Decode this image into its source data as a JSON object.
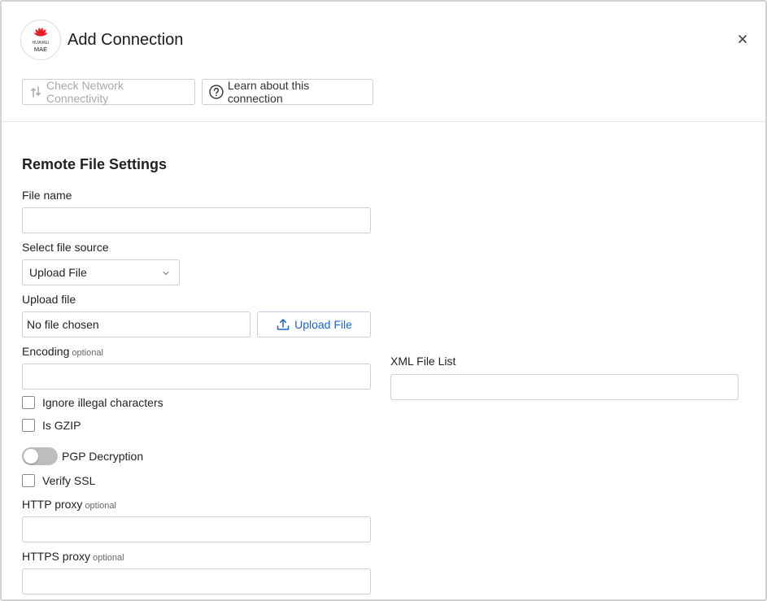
{
  "dialog": {
    "title": "Add Connection",
    "logo": {
      "brand": "HUAWEI",
      "sub": "MAE",
      "icon": "huawei-petal-logo",
      "color": "#e4202c"
    }
  },
  "toolbar": {
    "check_label": "Check Network Connectivity",
    "learn_label": "Learn about this connection"
  },
  "form": {
    "section_title": "Remote File Settings",
    "file_name": {
      "label": "File name",
      "value": ""
    },
    "file_source": {
      "label": "Select file source",
      "selected": "Upload File"
    },
    "upload_file": {
      "label": "Upload file",
      "status": "No file chosen",
      "button_label": "Upload File"
    },
    "encoding": {
      "label": "Encoding",
      "optional": "optional",
      "value": ""
    },
    "ignore_illegal": {
      "label": "Ignore illegal characters",
      "checked": false
    },
    "is_gzip": {
      "label": "Is GZIP",
      "checked": false
    },
    "pgp": {
      "label": "PGP Decryption",
      "enabled": false
    },
    "verify_ssl": {
      "label": "Verify SSL",
      "checked": false
    },
    "http_proxy": {
      "label": "HTTP proxy",
      "optional": "optional",
      "value": ""
    },
    "https_proxy": {
      "label": "HTTPS proxy",
      "optional": "optional",
      "value": ""
    },
    "xml_file_list": {
      "label": "XML File List",
      "value": ""
    }
  },
  "colors": {
    "accent": "#1b66c9",
    "border": "#cfcfcf",
    "disabled_text": "#a9a9a9",
    "toggle_off": "#bdbdbd"
  }
}
